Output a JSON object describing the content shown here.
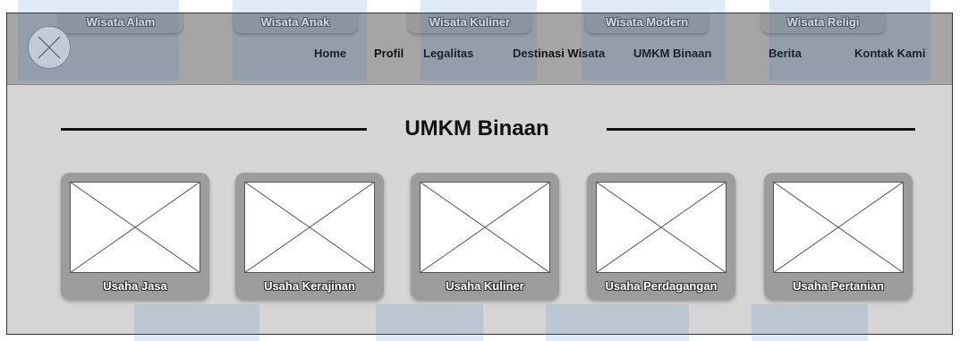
{
  "categories": [
    "Wisata Alam",
    "Wisata Anak",
    "Wisata Kuliner",
    "Wisata Modern",
    "Wisata Religi"
  ],
  "nav": {
    "home": "Home",
    "profil": "Profil",
    "legalitas": "Legalitas",
    "destinasi": "Destinasi Wisata",
    "umkm": "UMKM Binaan",
    "berita": "Berita",
    "kontak": "Kontak Kami"
  },
  "logo_icon": "image-placeholder-icon",
  "section_title": "UMKM Binaan",
  "cards": [
    {
      "label": "Usaha Jasa"
    },
    {
      "label": "Usaha Kerajinan"
    },
    {
      "label": "Usaha Kuliner"
    },
    {
      "label": "Usaha Perdagangan"
    },
    {
      "label": "Usaha Pertanian"
    }
  ],
  "colors": {
    "topbar": "#a5a5a5",
    "content": "#d5d5d5",
    "card": "#9c9c9c",
    "watermark": "#3b7fc4"
  }
}
